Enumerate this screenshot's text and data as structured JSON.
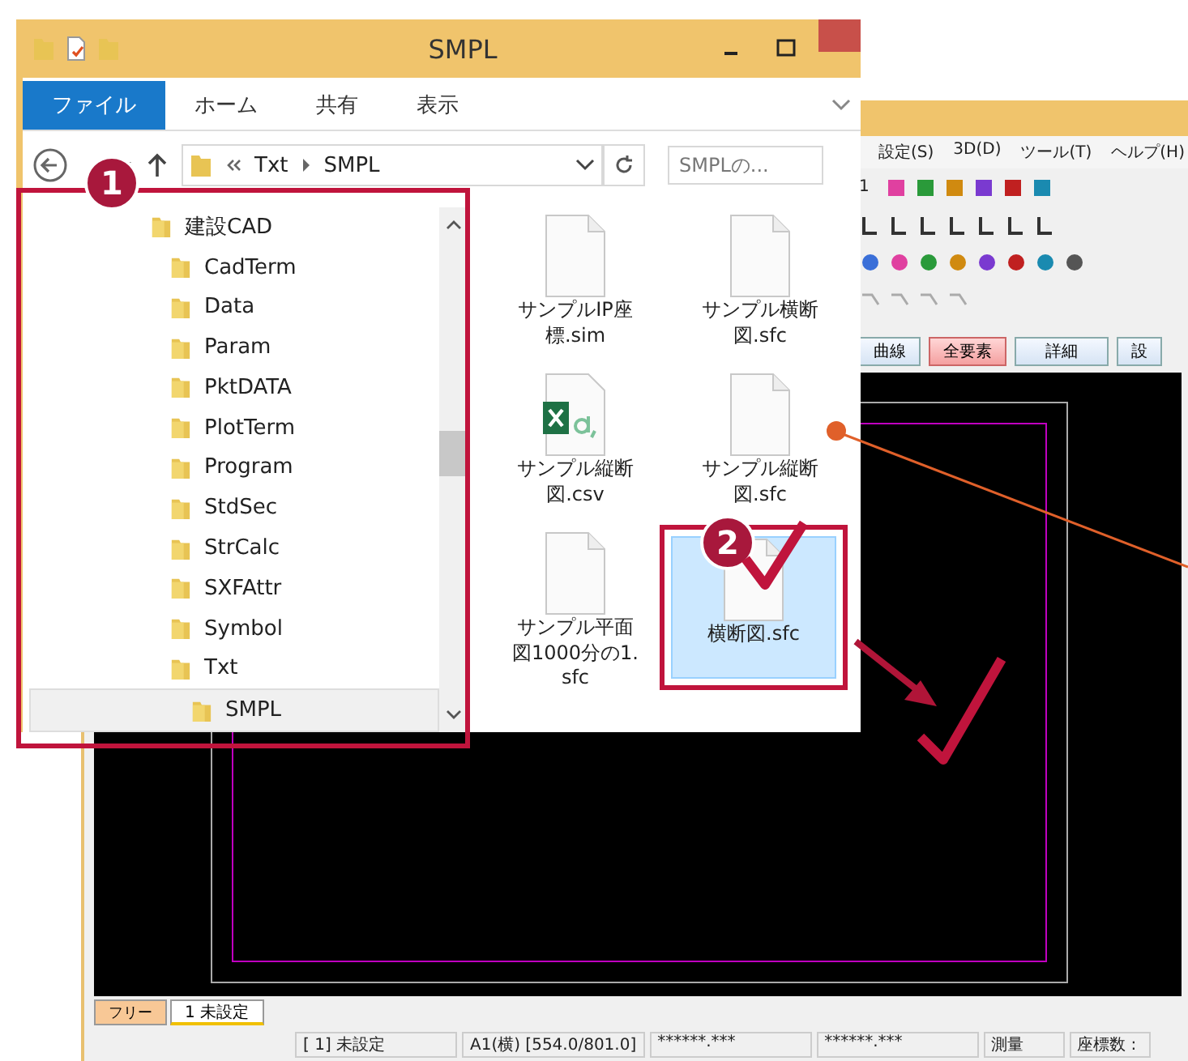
{
  "cad_window": {
    "menu": [
      "設定(S)",
      "3D(D)",
      "ツール(T)",
      "ヘルプ(H)"
    ],
    "page_number": "1",
    "mode_buttons": [
      {
        "label": "曲線",
        "selected": false
      },
      {
        "label": "全要素",
        "selected": true
      },
      {
        "label": "詳細",
        "selected": false
      },
      {
        "label": "設",
        "selected": false
      }
    ],
    "sheet_tabs": [
      {
        "label": "フリー",
        "selected": false
      },
      {
        "label": "1 未設定",
        "selected": true
      }
    ],
    "status_bar": [
      "[ 1] 未設定",
      "A1(横) [554.0/801.0]",
      "******.***",
      "******.***",
      "測量",
      "座標数 :"
    ]
  },
  "explorer": {
    "title": "SMPL",
    "ribbon_tabs": [
      {
        "label": "ファイル",
        "selected": true
      },
      {
        "label": "ホーム",
        "selected": false
      },
      {
        "label": "共有",
        "selected": false
      },
      {
        "label": "表示",
        "selected": false
      }
    ],
    "breadcrumb": [
      "Txt",
      "SMPL"
    ],
    "search": {
      "placeholder": "SMPLの..."
    },
    "nav_tree": [
      {
        "label": "建設CAD",
        "selected": false,
        "children": [
          {
            "label": "CadTerm",
            "selected": false
          },
          {
            "label": "Data",
            "selected": false
          },
          {
            "label": "Param",
            "selected": false
          },
          {
            "label": "PktDATA",
            "selected": false
          },
          {
            "label": "PlotTerm",
            "selected": false
          },
          {
            "label": "Program",
            "selected": false
          },
          {
            "label": "StdSec",
            "selected": false
          },
          {
            "label": "StrCalc",
            "selected": false
          },
          {
            "label": "SXFAttr",
            "selected": false
          },
          {
            "label": "Symbol",
            "selected": false
          },
          {
            "label": "Txt",
            "selected": false,
            "children": [
              {
                "label": "SMPL",
                "selected": true
              }
            ]
          }
        ]
      }
    ],
    "files": [
      {
        "name": "サンプルIP座標.sim",
        "kind": "document",
        "selected": false
      },
      {
        "name": "サンプル横断図.sfc",
        "kind": "document",
        "selected": false
      },
      {
        "name": "サンプル縦断図.csv",
        "kind": "spreadsheet",
        "selected": false
      },
      {
        "name": "サンプル縦断図.sfc",
        "kind": "document",
        "selected": false
      },
      {
        "name": "サンプル平面図1000分の1.sfc",
        "kind": "document",
        "selected": false
      },
      {
        "name": "横断図.sfc",
        "kind": "document",
        "selected": true
      }
    ]
  },
  "callouts": [
    "1",
    "2"
  ]
}
